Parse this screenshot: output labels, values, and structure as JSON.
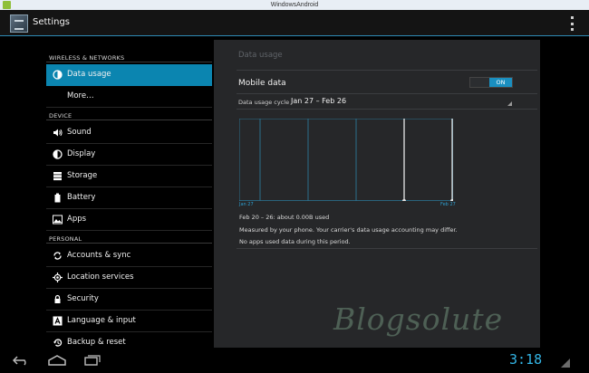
{
  "window": {
    "title": "WindowsAndroid"
  },
  "action_bar": {
    "title": "Settings"
  },
  "sidebar": {
    "sections": [
      {
        "header": "WIRELESS & NETWORKS"
      },
      {
        "header": "DEVICE"
      },
      {
        "header": "PERSONAL"
      }
    ],
    "items": [
      {
        "label": "Data usage",
        "icon": "data-usage-icon",
        "active": true
      },
      {
        "label": "More…",
        "icon": "",
        "active": false
      },
      {
        "label": "Sound",
        "icon": "speaker-icon",
        "active": false
      },
      {
        "label": "Display",
        "icon": "display-icon",
        "active": false
      },
      {
        "label": "Storage",
        "icon": "storage-icon",
        "active": false
      },
      {
        "label": "Battery",
        "icon": "battery-icon",
        "active": false
      },
      {
        "label": "Apps",
        "icon": "apps-icon",
        "active": false
      },
      {
        "label": "Accounts & sync",
        "icon": "sync-icon",
        "active": false
      },
      {
        "label": "Location services",
        "icon": "location-icon",
        "active": false
      },
      {
        "label": "Security",
        "icon": "lock-icon",
        "active": false
      },
      {
        "label": "Language & input",
        "icon": "language-icon",
        "active": false
      },
      {
        "label": "Backup & reset",
        "icon": "backup-icon",
        "active": false
      }
    ]
  },
  "content": {
    "title": "Data usage",
    "mobile_data_label": "Mobile data",
    "toggle_state": "ON",
    "cycle_label": "Data usage cycle",
    "cycle_value": "Jan 27 – Feb 26",
    "chart": {
      "start_label": "Jan 27",
      "end_label": "Feb 27"
    },
    "usage_text": "Feb 20 – 26: about 0.00B used",
    "measured_text": "Measured by your phone. Your carrier's data usage accounting may differ.",
    "no_apps_text": "No apps used data during this period."
  },
  "watermark": "Blogsolute",
  "status": {
    "clock": "3:18"
  },
  "colors": {
    "accent": "#33b5e5",
    "active_item": "#0b85b0",
    "panel": "#262729"
  }
}
